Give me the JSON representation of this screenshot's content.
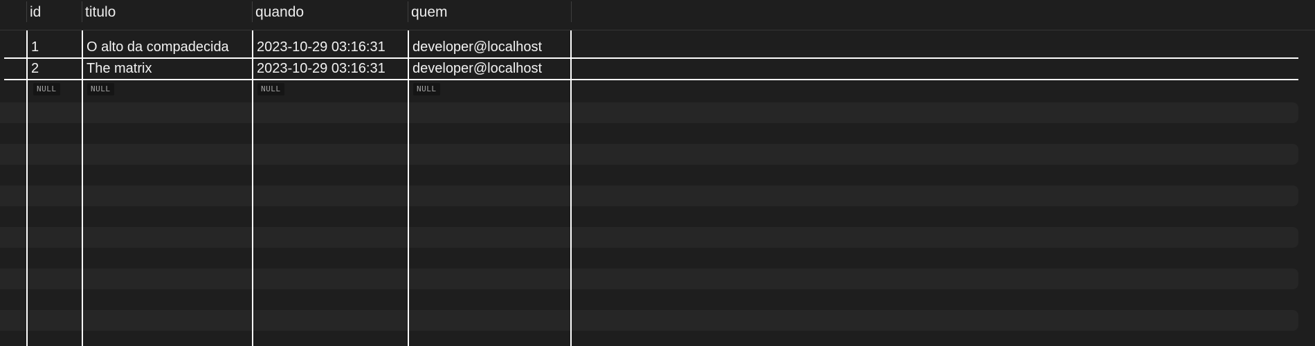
{
  "columns": [
    {
      "label": "id"
    },
    {
      "label": "titulo"
    },
    {
      "label": "quando"
    },
    {
      "label": "quem"
    }
  ],
  "rows": [
    {
      "id": "1",
      "titulo": "O alto da compadecida",
      "quando": "2023-10-29 03:16:31",
      "quem": "developer@localhost"
    },
    {
      "id": "2",
      "titulo": "The matrix",
      "quando": "2023-10-29 03:16:31",
      "quem": "developer@localhost"
    }
  ],
  "new_row": {
    "placeholder": "NULL"
  }
}
